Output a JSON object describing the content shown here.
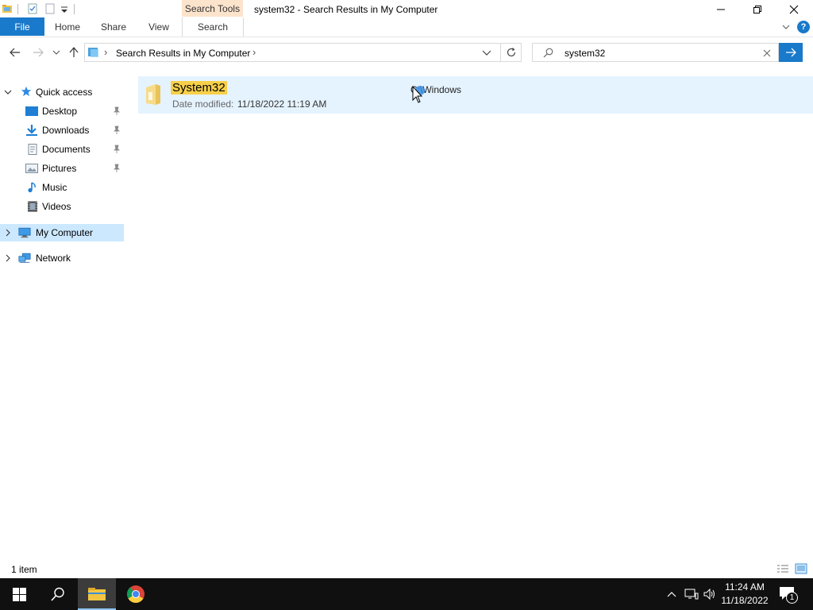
{
  "window": {
    "title": "system32 - Search Results in My Computer",
    "contextual_tab_header": "Search Tools"
  },
  "ribbon": {
    "tabs": [
      {
        "label": "File"
      },
      {
        "label": "Home"
      },
      {
        "label": "Share"
      },
      {
        "label": "View"
      },
      {
        "label": "Search"
      }
    ]
  },
  "address": {
    "crumb": "Search Results in My Computer",
    "separator": "›"
  },
  "search": {
    "value": "system32",
    "placeholder": ""
  },
  "nav": {
    "quick_access": "Quick access",
    "quick_items": [
      {
        "label": "Desktop",
        "icon": "desktop-icon",
        "pinned": true
      },
      {
        "label": "Downloads",
        "icon": "downloads-icon",
        "pinned": true
      },
      {
        "label": "Documents",
        "icon": "documents-icon",
        "pinned": true
      },
      {
        "label": "Pictures",
        "icon": "pictures-icon",
        "pinned": true
      },
      {
        "label": "Music",
        "icon": "music-icon",
        "pinned": false
      },
      {
        "label": "Videos",
        "icon": "videos-icon",
        "pinned": false
      }
    ],
    "my_computer": "My Computer",
    "network": "Network"
  },
  "results": [
    {
      "name": "System32",
      "date_label": "Date modified:",
      "date_value": "11/18/2022 11:19 AM",
      "location": "C:\\Windows"
    }
  ],
  "status": {
    "count": "1 item"
  },
  "taskbar": {
    "time": "11:24 AM",
    "date": "11/18/2022",
    "notification_count": "1"
  },
  "colors": {
    "accent": "#1979ca",
    "selection": "#e5f3ff",
    "nav_selected": "#cce8ff",
    "highlight": "#f7d04a",
    "taskbar": "#101010",
    "contextual_tab": "#fce4cc"
  }
}
